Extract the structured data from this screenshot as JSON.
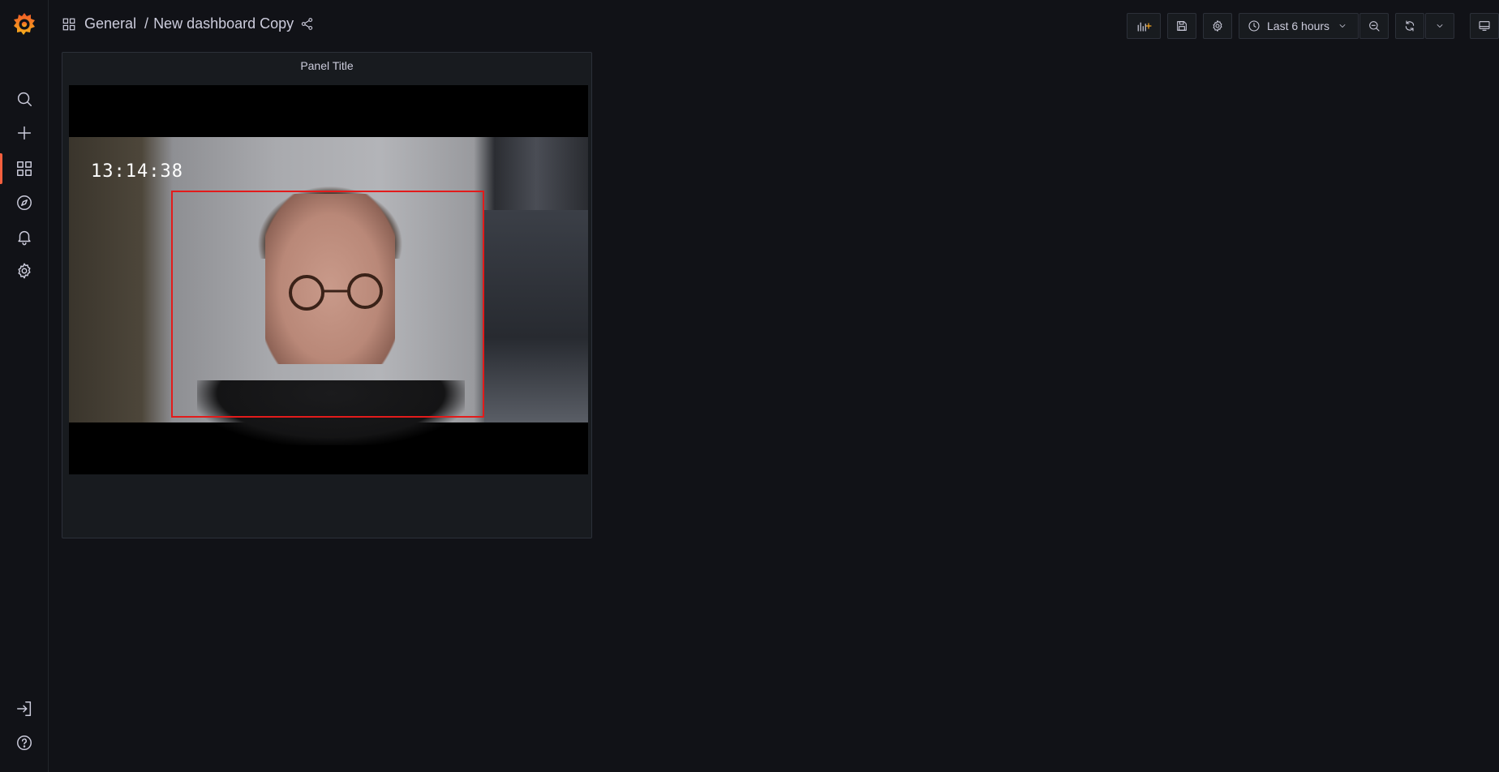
{
  "sidebar": {
    "logo": "grafana-logo",
    "items": [
      {
        "name": "search",
        "icon": "search-icon"
      },
      {
        "name": "create",
        "icon": "plus-icon"
      },
      {
        "name": "dashboards",
        "icon": "apps-icon",
        "active": true
      },
      {
        "name": "explore",
        "icon": "compass-icon"
      },
      {
        "name": "alerting",
        "icon": "bell-icon"
      },
      {
        "name": "configuration",
        "icon": "gear-icon"
      }
    ],
    "bottom_items": [
      {
        "name": "sign-in",
        "icon": "sign-in-icon"
      },
      {
        "name": "help",
        "icon": "help-icon"
      }
    ],
    "active_color": "#f55f3e"
  },
  "header": {
    "folder": "General",
    "separator": "/",
    "dashboard_title": "New dashboard Copy",
    "time_range": "Last 6 hours",
    "toolbar_icons": [
      "add-panel-icon",
      "save-icon",
      "settings-icon",
      "clock-icon",
      "chevron-down-icon",
      "zoom-out-icon",
      "refresh-icon",
      "chevron-down-icon",
      "tv-icon"
    ]
  },
  "panel": {
    "title": "Panel Title",
    "video": {
      "timestamp": "13:14:38",
      "detection_box_color": "#e31b1b"
    }
  }
}
